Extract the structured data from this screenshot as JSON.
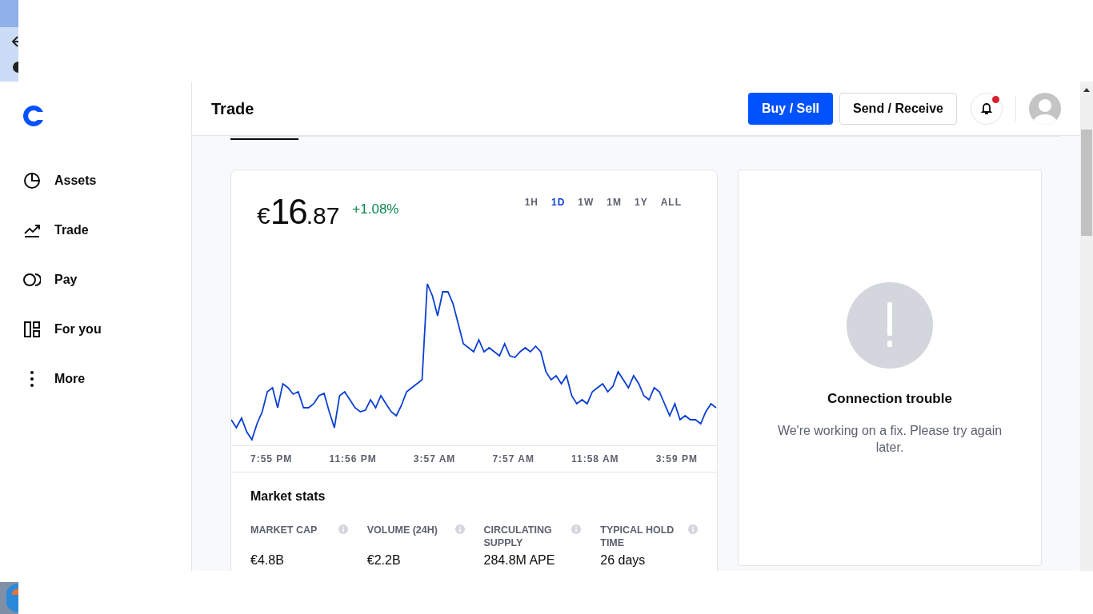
{
  "sidebar": {
    "items": [
      {
        "kind": "pie",
        "label": "Assets"
      },
      {
        "kind": "trend",
        "label": "Trade"
      },
      {
        "kind": "pay",
        "label": "Pay"
      },
      {
        "kind": "grid",
        "label": "For you"
      },
      {
        "kind": "dots",
        "label": "More"
      }
    ]
  },
  "header": {
    "title": "Trade",
    "buttons": [
      {
        "kind": "primary",
        "label": "Buy / Sell"
      },
      {
        "kind": "secondary",
        "label": "Send / Receive"
      }
    ],
    "notifications": {
      "unread": true
    }
  },
  "price_card": {
    "price": {
      "symbol": "€",
      "whole": "16",
      "fraction": ".87"
    },
    "change": "+1.08%",
    "ranges": [
      {
        "label": "1H",
        "selected": false
      },
      {
        "label": "1D",
        "selected": true
      },
      {
        "label": "1W",
        "selected": false
      },
      {
        "label": "1M",
        "selected": false
      },
      {
        "label": "1Y",
        "selected": false
      },
      {
        "label": "ALL",
        "selected": false
      }
    ],
    "time_labels": [
      "7:55 PM",
      "11:56 PM",
      "3:57 AM",
      "7:57 AM",
      "11:58 AM",
      "3:59 PM"
    ],
    "market_stats": {
      "title": "Market stats",
      "stats": [
        {
          "label": "MARKET CAP",
          "value": "€4.8B"
        },
        {
          "label": "VOLUME (24H)",
          "value": "€2.2B"
        },
        {
          "label": "CIRCULATING SUPPLY",
          "value": "284.8M APE"
        },
        {
          "label": "TYPICAL HOLD TIME",
          "value": "26 days"
        }
      ]
    }
  },
  "error_panel": {
    "title": "Connection trouble",
    "message": "We're working on a fix. Please try again later."
  }
}
